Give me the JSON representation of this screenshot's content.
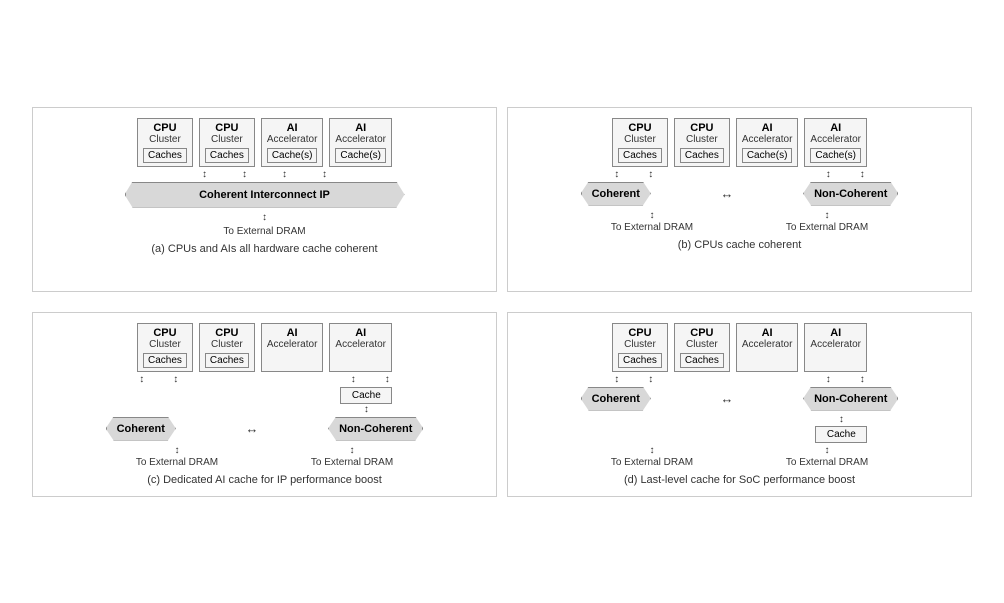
{
  "diagrams": [
    {
      "id": "diagram-a",
      "caption": "(a) CPUs and AIs all hardware cache coherent",
      "nodes": [
        {
          "title": "CPU",
          "sub": "Cluster",
          "cache": "Caches"
        },
        {
          "title": "CPU",
          "sub": "Cluster",
          "cache": "Caches"
        },
        {
          "title": "AI",
          "sub": "Accelerator",
          "cache": "Cache(s)"
        },
        {
          "title": "AI",
          "sub": "Accelerator",
          "cache": "Cache(s)"
        }
      ],
      "interconnect": "Coherent Interconnect IP",
      "dram_labels": [
        "To External DRAM"
      ],
      "type": "single-banner"
    },
    {
      "id": "diagram-b",
      "caption": "(b) CPUs cache coherent",
      "nodes": [
        {
          "title": "CPU",
          "sub": "Cluster",
          "cache": "Caches"
        },
        {
          "title": "CPU",
          "sub": "Cluster",
          "cache": "Caches"
        },
        {
          "title": "AI",
          "sub": "Accelerator",
          "cache": "Cache(s)"
        },
        {
          "title": "AI",
          "sub": "Accelerator",
          "cache": "Cache(s)"
        }
      ],
      "banner_left": "Coherent",
      "banner_right": "Non-Coherent",
      "dram_left": "To External DRAM",
      "dram_right": "To External DRAM",
      "type": "dual-banner"
    },
    {
      "id": "diagram-c",
      "caption": "(c) Dedicated AI cache for IP performance boost",
      "nodes": [
        {
          "title": "CPU",
          "sub": "Cluster",
          "cache": "Caches"
        },
        {
          "title": "CPU",
          "sub": "Cluster",
          "cache": "Caches"
        },
        {
          "title": "AI",
          "sub": "Accelerator",
          "cache": null
        },
        {
          "title": "AI",
          "sub": "Accelerator",
          "cache": null
        }
      ],
      "ai_cache": "Cache",
      "banner_left": "Coherent",
      "banner_right": "Non-Coherent",
      "dram_left": "To External DRAM",
      "dram_right": "To External DRAM",
      "type": "dual-banner-with-ai-cache"
    },
    {
      "id": "diagram-d",
      "caption": "(d) Last-level cache for SoC performance boost",
      "nodes": [
        {
          "title": "CPU",
          "sub": "Cluster",
          "cache": "Caches"
        },
        {
          "title": "CPU",
          "sub": "Cluster",
          "cache": "Caches"
        },
        {
          "title": "AI",
          "sub": "Accelerator",
          "cache": null
        },
        {
          "title": "AI",
          "sub": "Accelerator",
          "cache": null
        }
      ],
      "llc": "Cache",
      "banner_left": "Coherent",
      "banner_right": "Non-Coherent",
      "dram_left": "To External DRAM",
      "dram_right": "To External DRAM",
      "type": "dual-banner-with-llc"
    }
  ]
}
